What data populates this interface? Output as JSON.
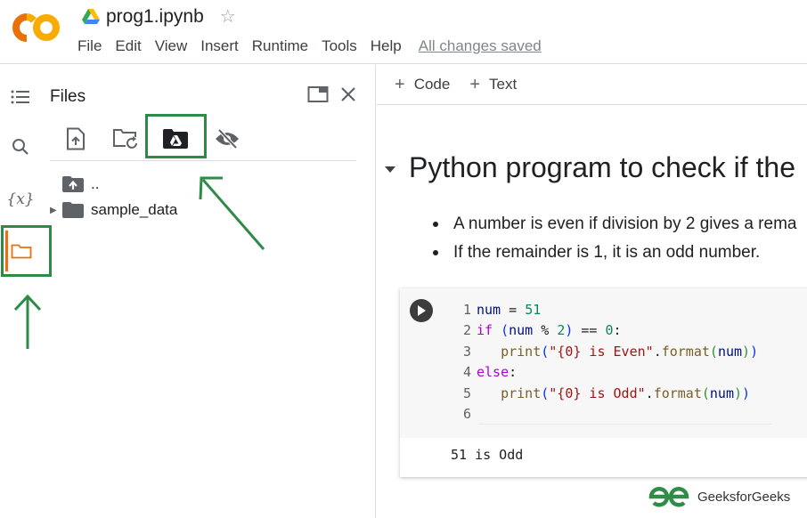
{
  "header": {
    "logo": "colab-logo",
    "doc_title": "prog1.ipynb",
    "menu": [
      "File",
      "Edit",
      "View",
      "Insert",
      "Runtime",
      "Tools",
      "Help"
    ],
    "save_status": "All changes saved"
  },
  "rail": {
    "items": [
      {
        "icon": "table-of-contents-icon"
      },
      {
        "icon": "search-icon"
      },
      {
        "icon": "variables-icon",
        "glyph": "{x}"
      },
      {
        "icon": "folder-icon",
        "active": true
      }
    ]
  },
  "files_panel": {
    "title": "Files",
    "toolbar": [
      "upload-file-icon",
      "refresh-folder-icon",
      "mount-drive-icon",
      "hide-files-icon"
    ],
    "tree": [
      {
        "name": "..",
        "icon": "parent-folder-icon"
      },
      {
        "name": "sample_data",
        "icon": "folder-icon",
        "expandable": true
      }
    ]
  },
  "notebook": {
    "toolbar": {
      "add_code": "Code",
      "add_text": "Text",
      "plus": "+"
    },
    "heading": "Python program to check if the",
    "bullets": [
      "A number is even if division by 2 gives a rema",
      "If the remainder is 1, it is an odd number."
    ],
    "cell": {
      "line_numbers": [
        "1",
        "2",
        "3",
        "4",
        "5",
        "6"
      ],
      "code_lines": [
        "num = 51",
        "if (num % 2) == 0:",
        "   print(\"{0} is Even\".format(num))",
        "else:",
        "   print(\"{0} is Odd\".format(num))",
        ""
      ],
      "tokens": {
        "l1": [
          "num",
          " = ",
          "51"
        ],
        "l2": [
          "if",
          " ",
          "(",
          "num",
          " % ",
          "2",
          ")",
          " == ",
          "0",
          ":"
        ],
        "l3": [
          "   ",
          "print",
          "(",
          "\"{0} is Even\"",
          ".",
          "format",
          "(",
          "num",
          ")",
          ")"
        ],
        "l4": [
          "else",
          ":"
        ],
        "l5": [
          "   ",
          "print",
          "(",
          "\"{0} is Odd\"",
          ".",
          "format",
          "(",
          "num",
          ")",
          ")"
        ]
      },
      "output": "51 is Odd"
    }
  },
  "watermark": "GeeksforGeeks",
  "colors": {
    "annotation_green": "#2e8b47",
    "active_orange": "#e8710a",
    "logo_orange": "#f9ab00"
  }
}
